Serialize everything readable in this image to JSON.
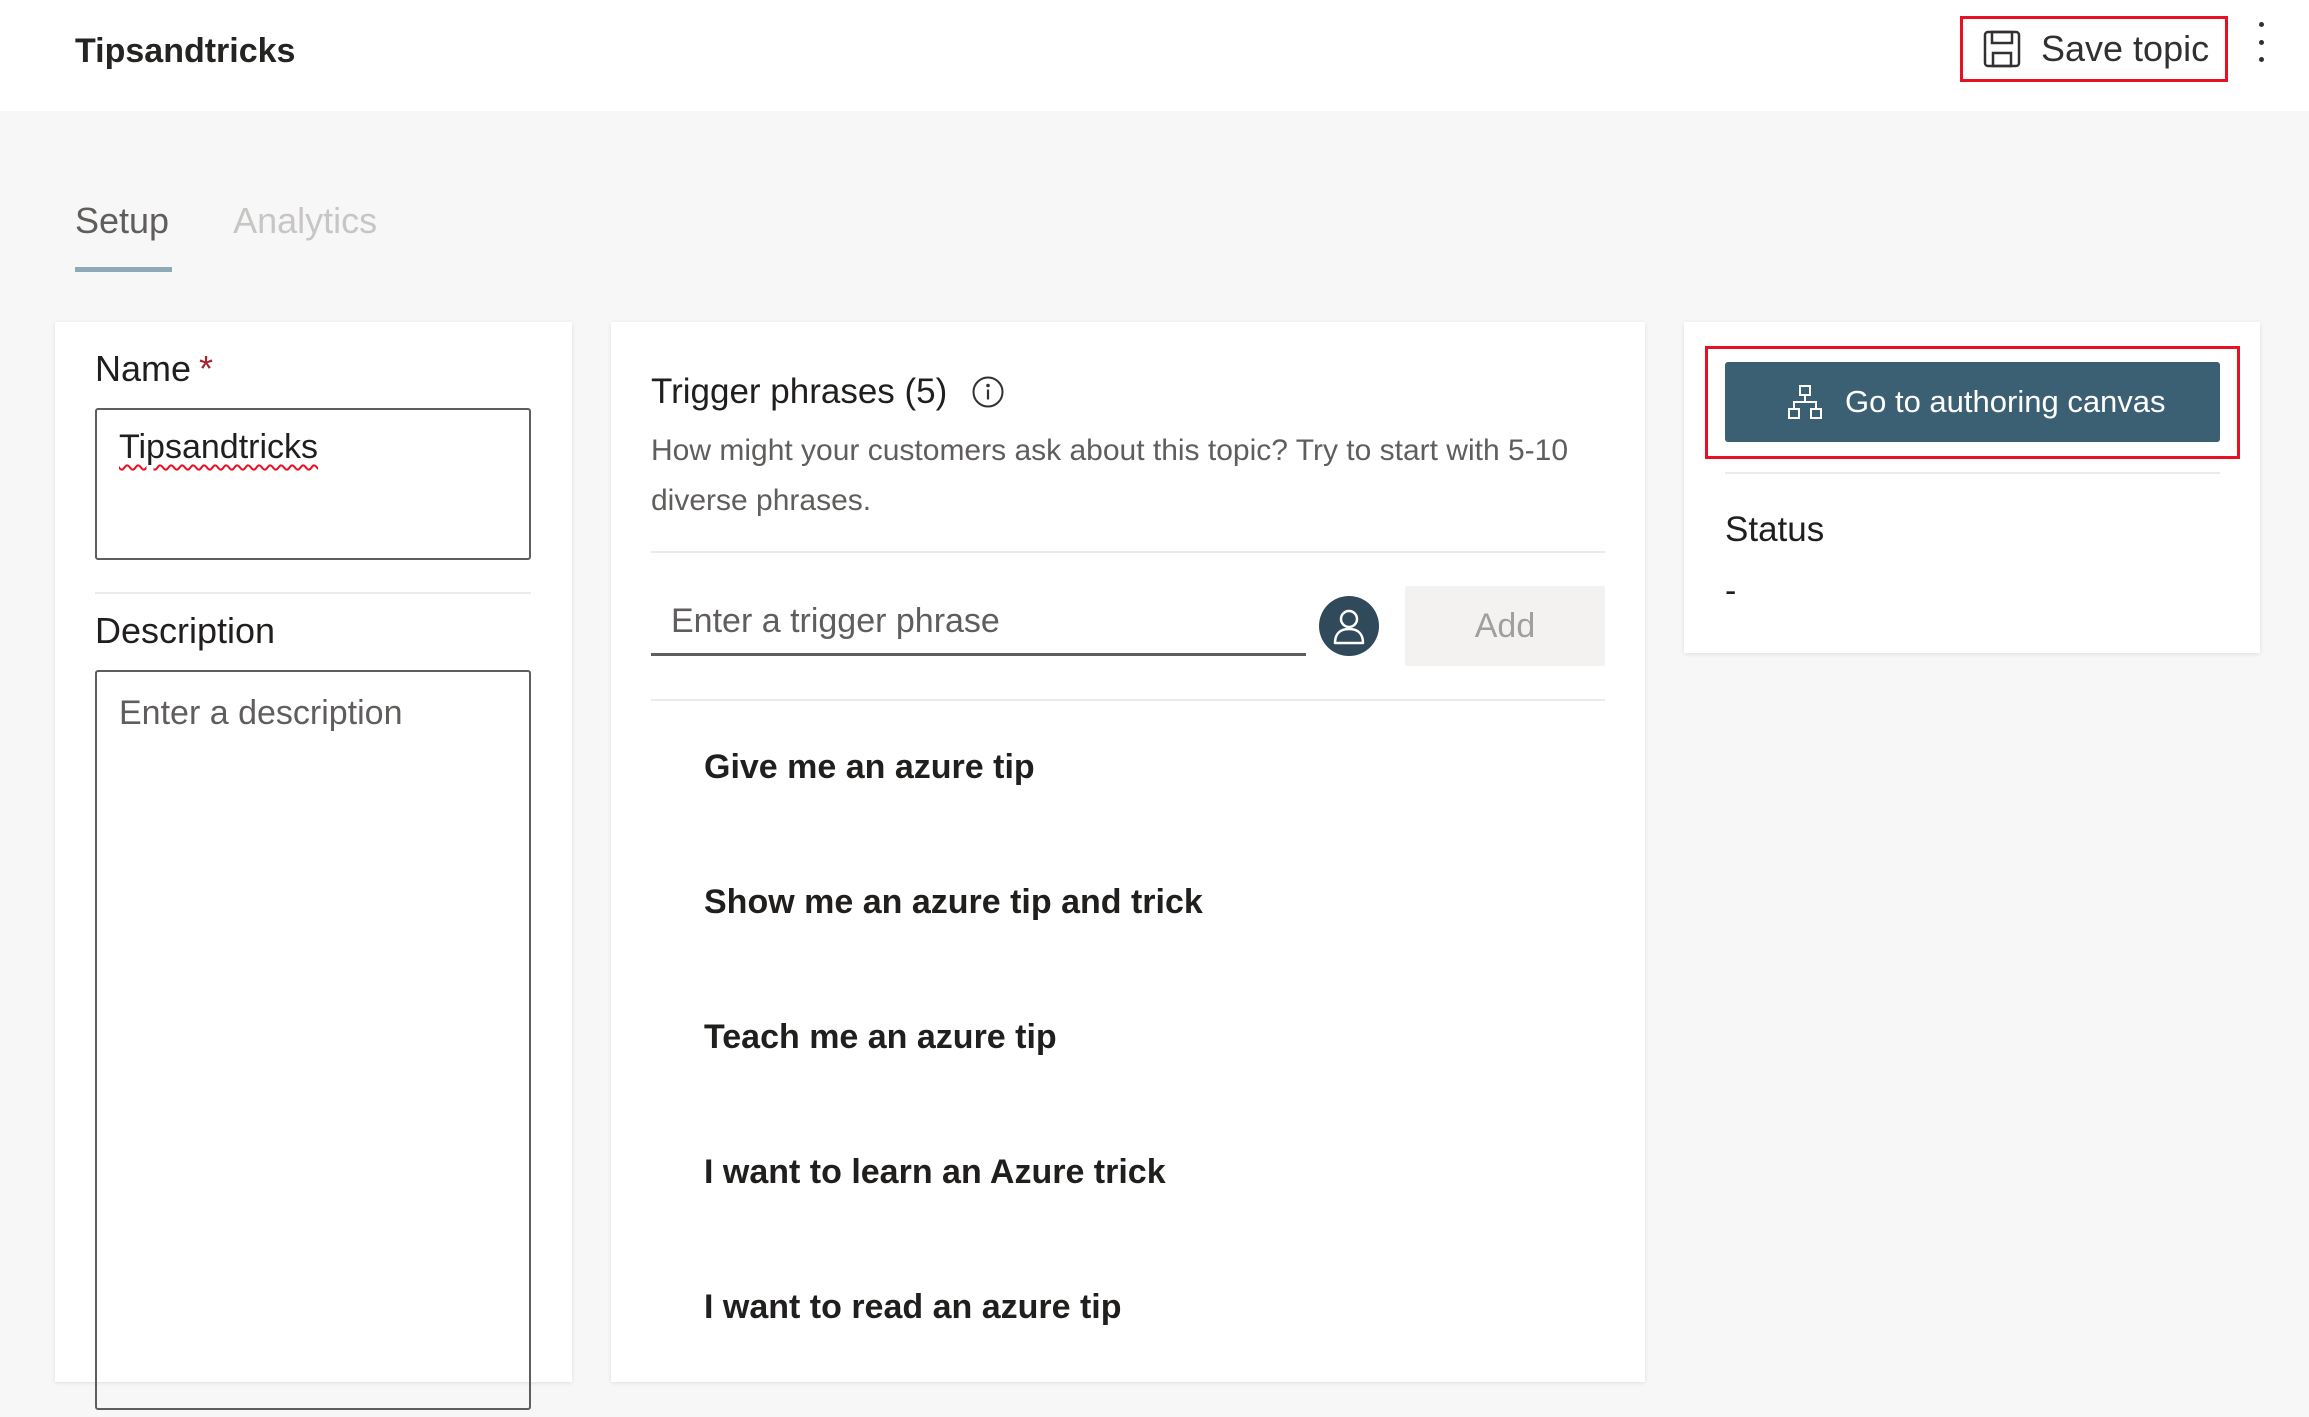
{
  "header": {
    "title": "Tipsandtricks",
    "save_label": "Save topic",
    "more_icon": "more-vertical-icon"
  },
  "tabs": [
    {
      "label": "Setup",
      "active": true
    },
    {
      "label": "Analytics",
      "active": false
    }
  ],
  "details": {
    "name_label": "Name",
    "required_marker": "*",
    "name_value": "Tipsandtricks",
    "description_label": "Description",
    "description_placeholder": "Enter a description"
  },
  "triggers": {
    "title": "Trigger phrases (5)",
    "help_text": "How might your customers ask about this topic? Try to start with 5-10 diverse phrases.",
    "input_placeholder": "Enter a trigger phrase",
    "add_label": "Add",
    "phrases": [
      "Give me an azure tip",
      "Show me an azure tip and trick",
      "Teach me an azure tip",
      "I want to learn an Azure trick",
      "I want to read an azure tip"
    ]
  },
  "side": {
    "canvas_button_label": "Go to authoring canvas",
    "status_label": "Status",
    "status_value": "-"
  },
  "colors": {
    "accent": "#3b5f73",
    "highlight": "#e81123",
    "required": "#a4262c"
  }
}
